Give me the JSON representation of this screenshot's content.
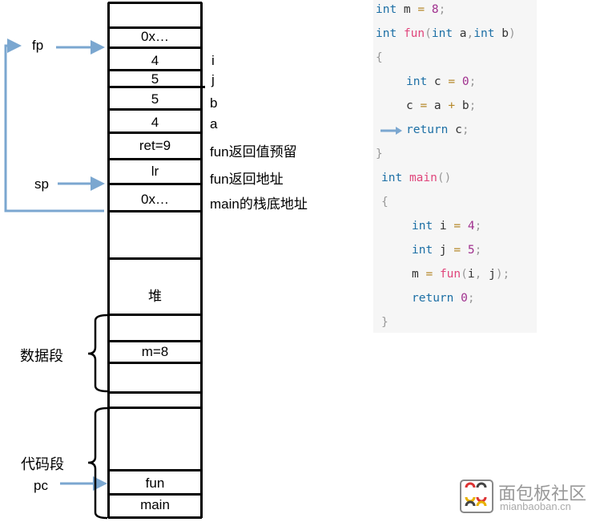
{
  "stack": {
    "cells": [
      "0x…",
      "4",
      "5",
      "5",
      "4",
      "ret=9",
      "lr",
      "0x…",
      "堆",
      "m=8",
      "fun",
      "main"
    ],
    "annotations": [
      "i",
      "j",
      "b",
      "a",
      "fun返回值预留",
      "fun返回地址",
      "main的栈底地址"
    ]
  },
  "pointers": {
    "fp": "fp",
    "sp": "sp",
    "pc": "pc"
  },
  "segments": {
    "data": "数据段",
    "code": "代码段"
  },
  "code_lines": [
    "int m = 8;",
    "int fun(int a,int b)",
    "{",
    "    int c = 0;",
    "    c = a + b;",
    "    return c;",
    "}",
    " int main()",
    " {",
    "     int i = 4;",
    "     int j = 5;",
    "     m = fun(i, j);",
    "     return 0;",
    " }"
  ],
  "logo": {
    "text": "面包板社区",
    "url_text": "mianbaoban.cn"
  },
  "colors": {
    "arrow": "#7ba7d0",
    "keyword": "#1c6fa5",
    "function": "#e0457b",
    "number": "#a0308e",
    "code_bg": "#f6f6f6"
  }
}
